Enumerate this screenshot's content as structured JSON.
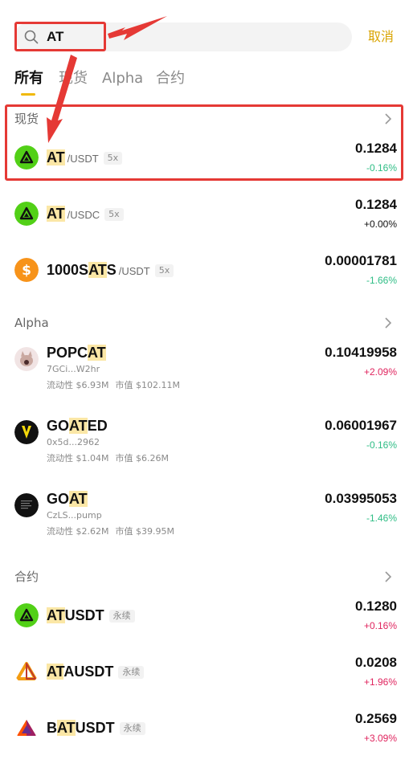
{
  "search": {
    "query": "AT",
    "cancel_label": "取消"
  },
  "tabs": [
    {
      "label": "所有",
      "active": true
    },
    {
      "label": "现货",
      "active": false
    },
    {
      "label": "Alpha",
      "active": false
    },
    {
      "label": "合约",
      "active": false
    }
  ],
  "sections": {
    "spot": {
      "title": "现货",
      "items": [
        {
          "pre": "",
          "hl": "AT",
          "post": "",
          "quote": "/USDT",
          "badge": "5x",
          "price": "0.1284",
          "change": "-0.16%",
          "direction": "down",
          "icon": "at-token-icon"
        },
        {
          "pre": "",
          "hl": "AT",
          "post": "",
          "quote": "/USDC",
          "badge": "5x",
          "price": "0.1284",
          "change": "+0.00%",
          "direction": "flat",
          "icon": "at-token-icon"
        },
        {
          "pre": "1000S",
          "hl": "AT",
          "post": "S",
          "quote": "/USDT",
          "badge": "5x",
          "price": "0.00001781",
          "change": "-1.66%",
          "direction": "down",
          "icon": "sats-token-icon"
        }
      ]
    },
    "alpha": {
      "title": "Alpha",
      "items": [
        {
          "pre": "POPC",
          "hl": "AT",
          "post": "",
          "address": "7GCi...W2hr",
          "liquidity": "流动性 $6.93M",
          "mcap": "市值 $102.11M",
          "price": "0.10419958",
          "change": "+2.09%",
          "direction": "up",
          "icon": "popcat-token-icon"
        },
        {
          "pre": "GO",
          "hl": "AT",
          "post": "ED",
          "address": "0x5d...2962",
          "liquidity": "流动性 $1.04M",
          "mcap": "市值 $6.26M",
          "price": "0.06001967",
          "change": "-0.16%",
          "direction": "down",
          "icon": "goated-token-icon"
        },
        {
          "pre": "GO",
          "hl": "AT",
          "post": "",
          "address": "CzLS...pump",
          "liquidity": "流动性 $2.62M",
          "mcap": "市值 $39.95M",
          "price": "0.03995053",
          "change": "-1.46%",
          "direction": "down",
          "icon": "goat-token-icon"
        }
      ]
    },
    "futures": {
      "title": "合约",
      "items": [
        {
          "pre": "",
          "hl": "AT",
          "post": "USDT",
          "badge": "永续",
          "price": "0.1280",
          "change": "+0.16%",
          "direction": "up",
          "icon": "at-token-icon"
        },
        {
          "pre": "",
          "hl": "AT",
          "post": "AUSDT",
          "badge": "永续",
          "price": "0.0208",
          "change": "+1.96%",
          "direction": "up",
          "icon": "ata-token-icon"
        },
        {
          "pre": "B",
          "hl": "AT",
          "post": "USDT",
          "badge": "永续",
          "price": "0.2569",
          "change": "+3.09%",
          "direction": "up",
          "icon": "bat-token-icon"
        }
      ]
    }
  },
  "colors": {
    "accent": "#f0b90b",
    "up": "#e0245e",
    "down": "#2ebd85",
    "annotation": "#e53935",
    "at_logo": "#52d017"
  }
}
